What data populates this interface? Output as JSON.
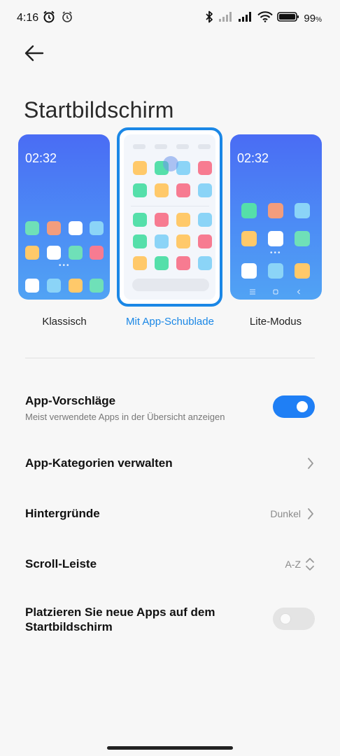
{
  "status_bar": {
    "time": "4:16",
    "battery": "99",
    "battery_unit": "%",
    "icons": [
      "alarm-icon",
      "timer-icon",
      "bluetooth-icon",
      "signal-icon",
      "signal-icon",
      "wifi-icon",
      "battery-icon"
    ]
  },
  "header": {
    "title": "Startbildschirm"
  },
  "layouts": [
    {
      "label": "Klassisch",
      "preview_time": "02:32",
      "selected": false
    },
    {
      "label": "Mit App-Schublade",
      "selected": true
    },
    {
      "label": "Lite-Modus",
      "preview_time": "02:32",
      "selected": false
    }
  ],
  "settings": {
    "suggestions": {
      "title": "App-Vorschläge",
      "subtitle": "Meist verwendete Apps in der Übersicht anzeigen",
      "enabled": true
    },
    "categories": {
      "title": "App-Kategorien verwalten"
    },
    "backgrounds": {
      "title": "Hintergründe",
      "value": "Dunkel"
    },
    "scrollbar": {
      "title": "Scroll-Leiste",
      "value": "A-Z"
    },
    "place_new": {
      "title_line1": "Platzieren Sie neue Apps auf dem",
      "title_line2": "Startbildschirm",
      "enabled": false
    }
  },
  "colors": {
    "accent": "#1a87e6",
    "toggle_on": "#1f7ff5",
    "toggle_off": "#e4e4e4"
  }
}
